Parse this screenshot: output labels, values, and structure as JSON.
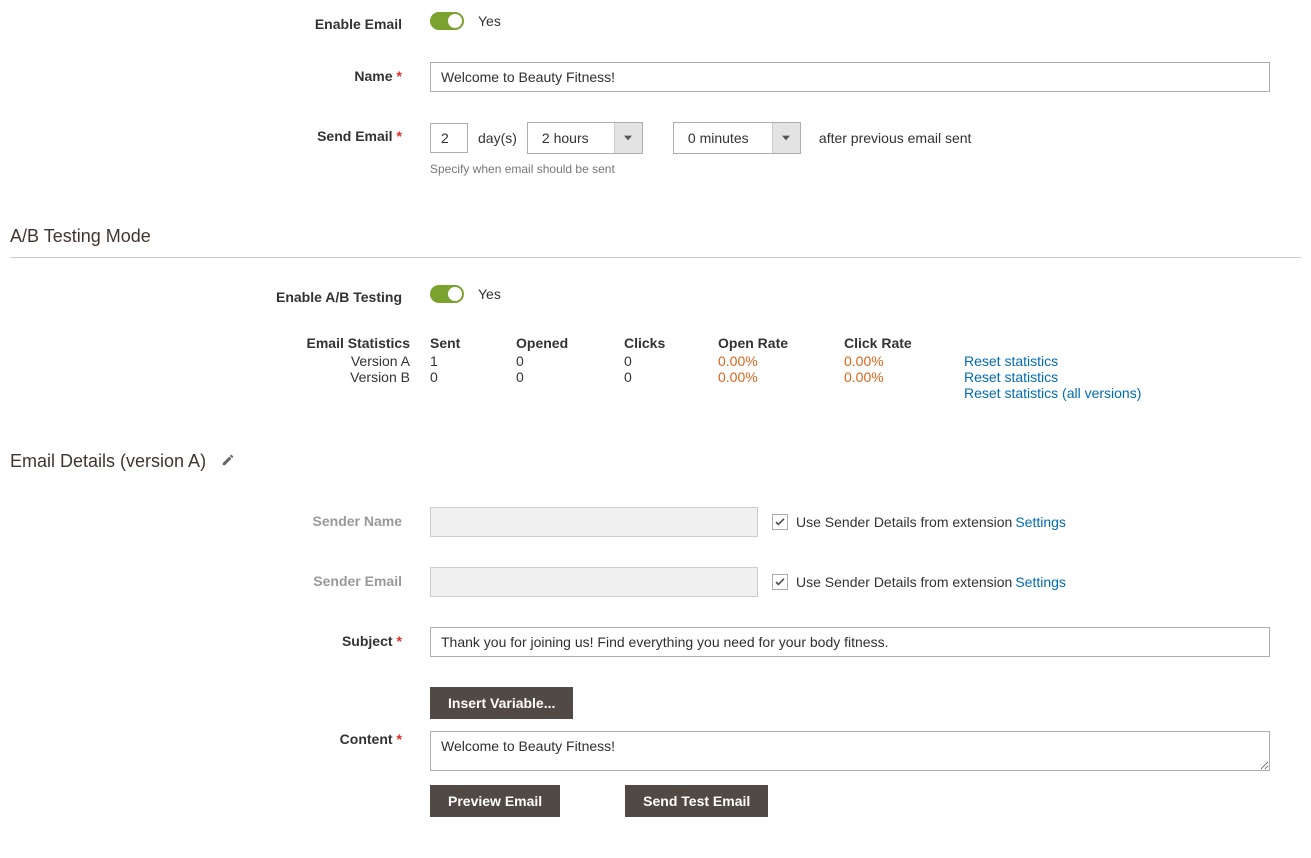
{
  "fields": {
    "enable_email_label": "Enable Email",
    "enable_email_value": "Yes",
    "name_label": "Name",
    "name_value": "Welcome to Beauty Fitness!",
    "send_email_label": "Send Email",
    "send_days_value": "2",
    "send_days_unit": "day(s)",
    "send_hours_value": "2 hours",
    "send_minutes_value": "0 minutes",
    "send_after_text": "after previous email sent",
    "send_hint": "Specify when email should be sent"
  },
  "ab": {
    "section_title": "A/B Testing Mode",
    "enable_label": "Enable A/B Testing",
    "enable_value": "Yes",
    "stats_title": "Email Statistics",
    "headers": {
      "sent": "Sent",
      "opened": "Opened",
      "clicks": "Clicks",
      "open_rate": "Open Rate",
      "click_rate": "Click Rate"
    },
    "rows": [
      {
        "label": "Version A",
        "sent": "1",
        "opened": "0",
        "clicks": "0",
        "open_rate": "0.00%",
        "click_rate": "0.00%",
        "reset": "Reset statistics"
      },
      {
        "label": "Version B",
        "sent": "0",
        "opened": "0",
        "clicks": "0",
        "open_rate": "0.00%",
        "click_rate": "0.00%",
        "reset": "Reset statistics"
      }
    ],
    "reset_all": "Reset statistics (all versions)"
  },
  "details": {
    "section_title": "Email Details (version A)",
    "sender_name_label": "Sender Name",
    "sender_email_label": "Sender Email",
    "use_sender_text": "Use Sender Details from extension",
    "settings_link": "Settings",
    "subject_label": "Subject",
    "subject_value": "Thank you for joining us! Find everything you need for your body fitness.",
    "insert_variable": "Insert Variable...",
    "content_label": "Content",
    "content_value": "Welcome to Beauty Fitness!",
    "preview_btn": "Preview Email",
    "send_test_btn": "Send Test Email"
  }
}
